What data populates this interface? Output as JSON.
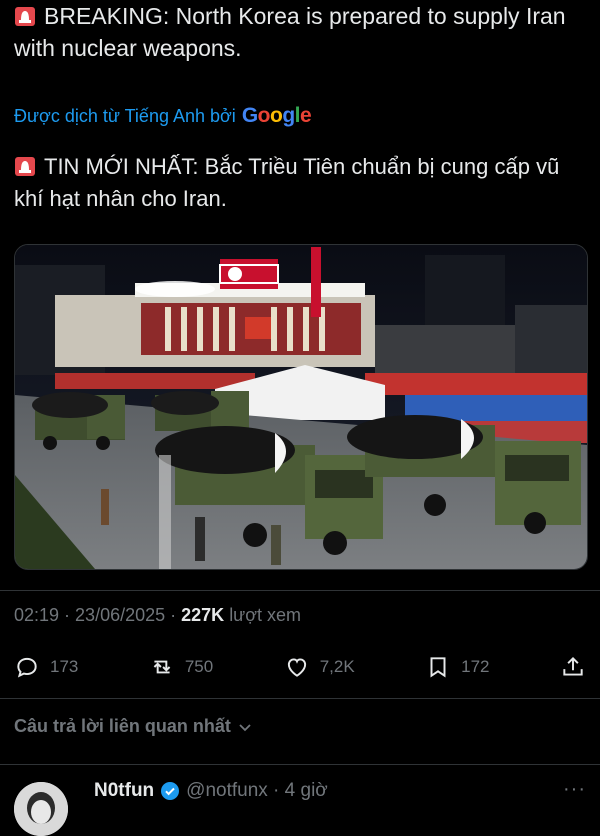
{
  "tweet": {
    "original_text": "BREAKING: North Korea is prepared to supply Iran with nuclear weapons.",
    "translated_by_label": "Được dịch từ Tiếng Anh bởi",
    "translated_by_brand": "Google",
    "translated_text": "TIN MỚI NHẤT: Bắc Triều Tiên chuẩn bị cung cấp vũ khí hạt nhân cho Iran.",
    "time": "02:19",
    "date": "23/06/2025",
    "views_count": "227K",
    "views_label": "lượt xem"
  },
  "actions": {
    "replies": "173",
    "reposts": "750",
    "likes": "7,2K",
    "bookmarks": "172"
  },
  "related_replies_label": "Câu trả lời liên quan nhất",
  "reply": {
    "name": "N0tfun",
    "handle": "@notfunx · 4 giờ",
    "more": "···"
  },
  "colors": {
    "background": "#000000",
    "text": "#e7e9ea",
    "muted": "#71767b",
    "link": "#1d9bf0",
    "verified": "#1d9bf0"
  }
}
